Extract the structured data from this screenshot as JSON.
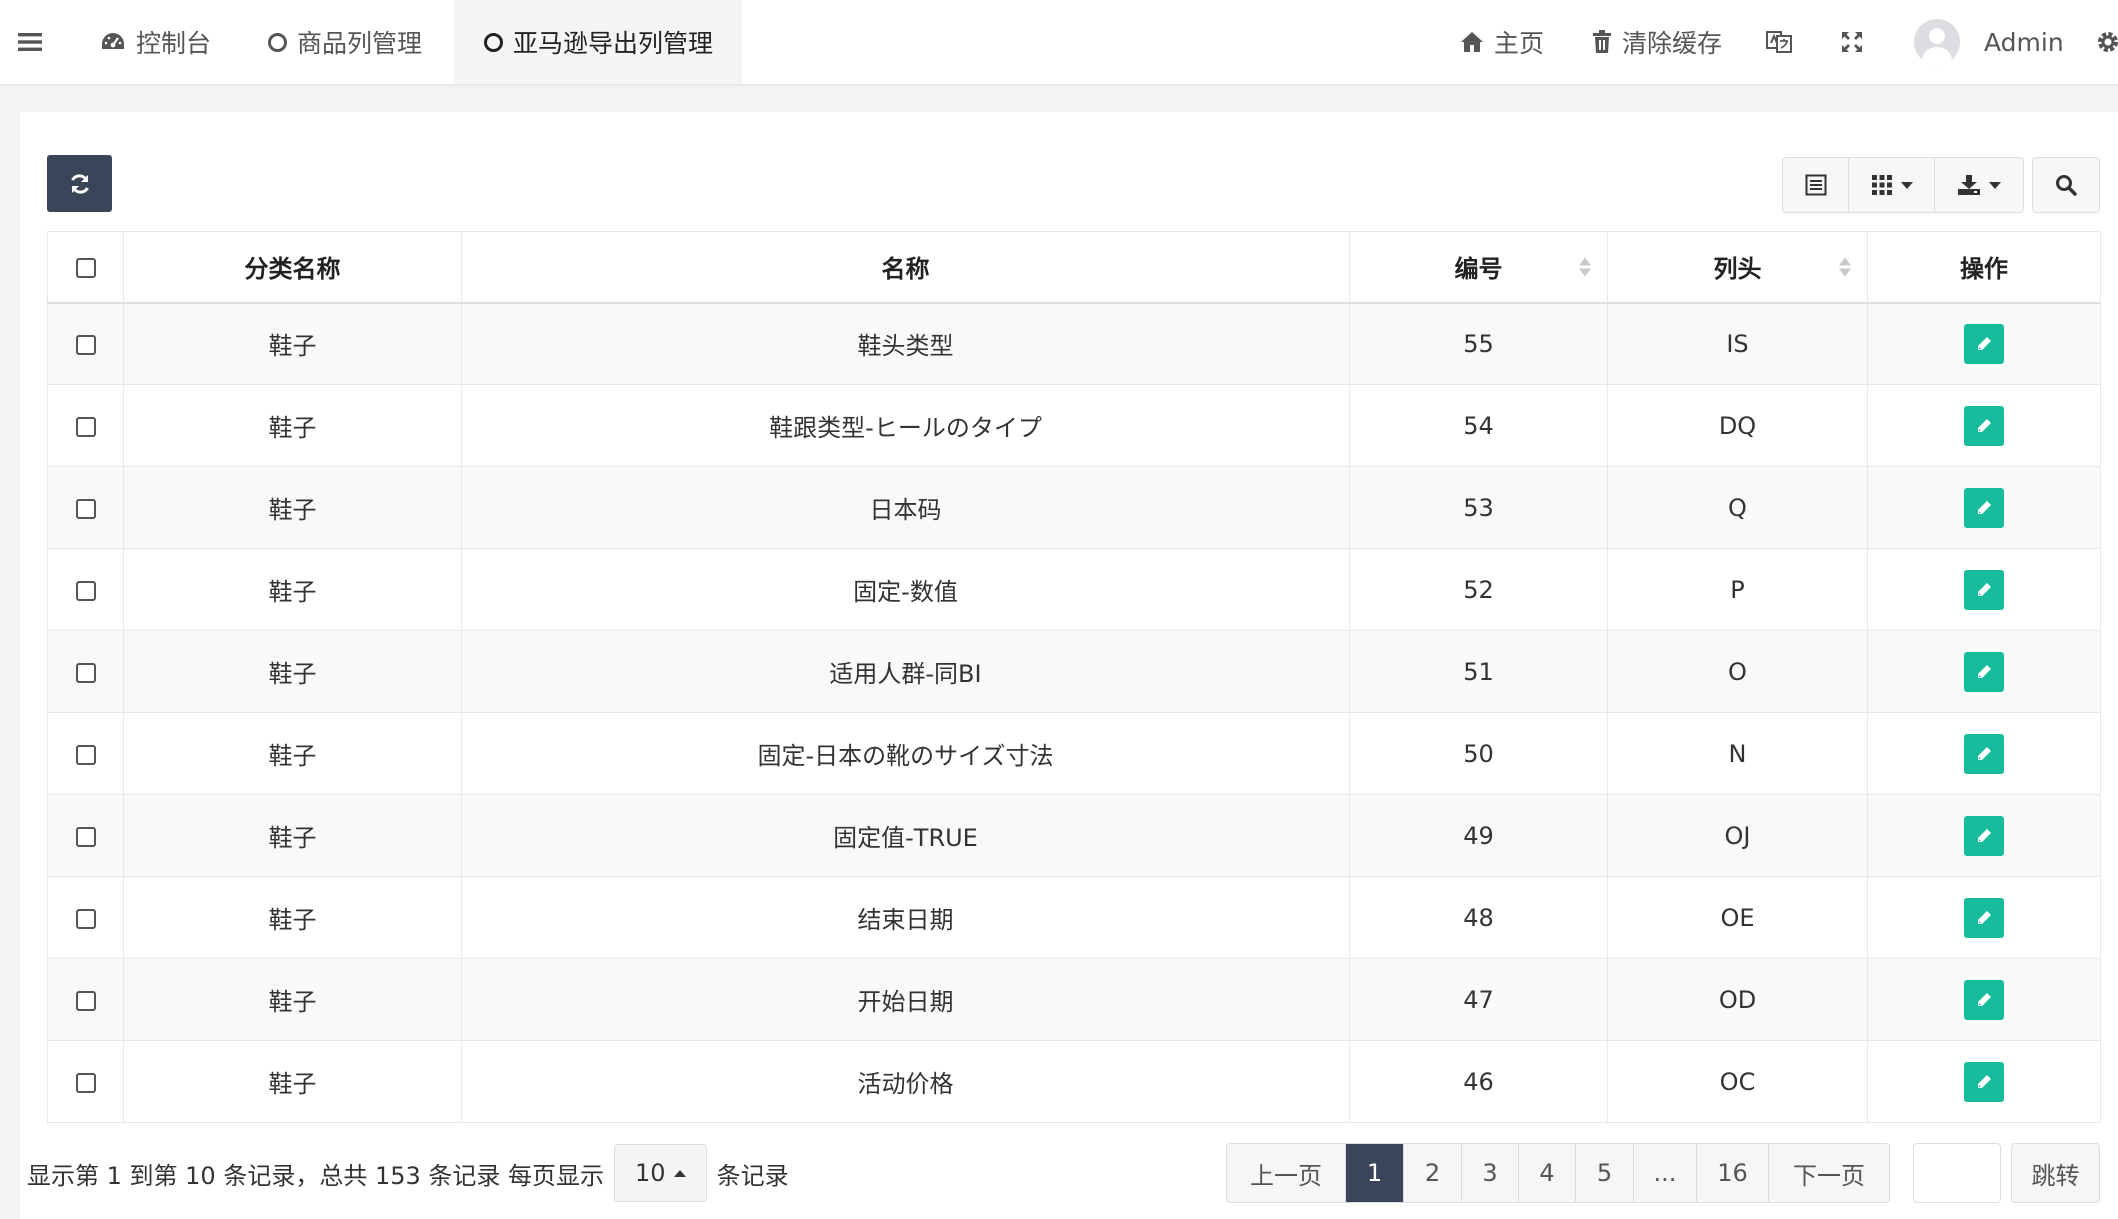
{
  "nav": {
    "tabs": [
      {
        "label": "控制台",
        "icon": "dashboard-icon"
      },
      {
        "label": "商品列管理",
        "icon": "circle-icon"
      },
      {
        "label": "亚马逊导出列管理",
        "icon": "circle-icon"
      }
    ],
    "home_label": "主页",
    "clear_cache_label": "清除缓存",
    "user_name": "Admin"
  },
  "table": {
    "columns": [
      "分类名称",
      "名称",
      "编号",
      "列头",
      "操作"
    ],
    "rows": [
      {
        "category": "鞋子",
        "name": "鞋头类型",
        "number": "55",
        "header": "IS"
      },
      {
        "category": "鞋子",
        "name": "鞋跟类型-ヒールのタイプ",
        "number": "54",
        "header": "DQ"
      },
      {
        "category": "鞋子",
        "name": "日本码",
        "number": "53",
        "header": "Q"
      },
      {
        "category": "鞋子",
        "name": "固定-数值",
        "number": "52",
        "header": "P"
      },
      {
        "category": "鞋子",
        "name": "适用人群-同BI",
        "number": "51",
        "header": "O"
      },
      {
        "category": "鞋子",
        "name": "固定-日本の靴のサイズ寸法",
        "number": "50",
        "header": "N"
      },
      {
        "category": "鞋子",
        "name": "固定值-TRUE",
        "number": "49",
        "header": "OJ"
      },
      {
        "category": "鞋子",
        "name": "结束日期",
        "number": "48",
        "header": "OE"
      },
      {
        "category": "鞋子",
        "name": "开始日期",
        "number": "47",
        "header": "OD"
      },
      {
        "category": "鞋子",
        "name": "活动价格",
        "number": "46",
        "header": "OC"
      }
    ]
  },
  "footer": {
    "info_prefix": "显示第 1 到第 10 条记录，总共 153 条记录 每页显示",
    "page_size": "10",
    "info_suffix": "条记录",
    "pager": [
      "上一页",
      "1",
      "2",
      "3",
      "4",
      "5",
      "...",
      "16",
      "下一页"
    ],
    "active_page": "1",
    "jump_label": "跳转"
  },
  "colors": {
    "primary_dark": "#3a4559",
    "edit_green": "#18bc9c"
  }
}
